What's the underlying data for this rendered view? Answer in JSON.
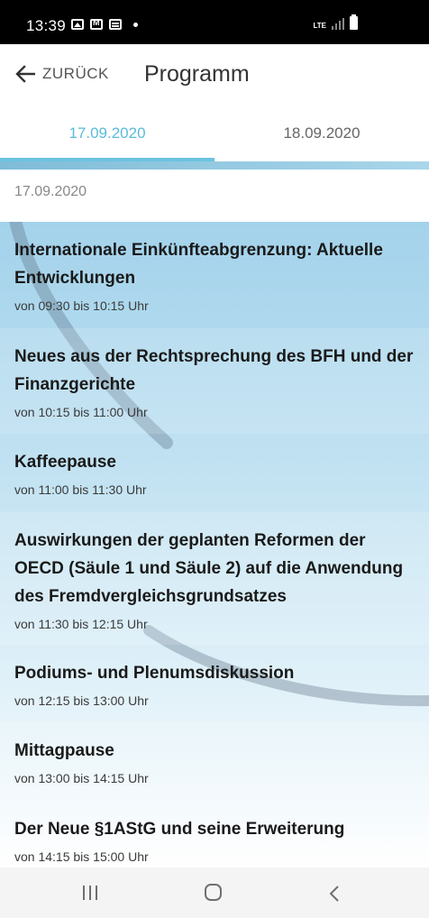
{
  "status_bar": {
    "time": "13:39",
    "network": "LTE"
  },
  "header": {
    "back_label": "ZURÜCK",
    "title": "Programm"
  },
  "tabs": [
    {
      "label": "17.09.2020",
      "active": true
    },
    {
      "label": "18.09.2020",
      "active": false
    }
  ],
  "schedule": {
    "date_header": "17.09.2020",
    "items": [
      {
        "title": "Internationale Einkünfteabgrenzung: Aktuelle Entwicklungen",
        "time": "von 09:30 bis 10:15 Uhr"
      },
      {
        "title": "Neues aus der Rechtsprechung des BFH und der Finanzgerichte",
        "time": "von 10:15 bis 11:00 Uhr"
      },
      {
        "title": "Kaffeepause",
        "time": "von 11:00 bis 11:30 Uhr"
      },
      {
        "title": "Auswirkungen der geplanten Reformen der OECD (Säule 1 und Säule 2) auf die Anwendung des Fremdvergleichsgrundsatzes",
        "time": "von 11:30 bis 12:15 Uhr"
      },
      {
        "title": "Podiums- und Plenumsdiskussion",
        "time": "von 12:15 bis 13:00 Uhr"
      },
      {
        "title": "Mittagpause",
        "time": "von 13:00 bis 14:15 Uhr"
      },
      {
        "title": "Der Neue §1AStG und seine Erweiterung",
        "time": "von 14:15 bis 15:00 Uhr"
      }
    ]
  },
  "colors": {
    "accent": "#5bbad8",
    "status_bar": "#000000",
    "nav_bar": "#f4f4f4"
  }
}
